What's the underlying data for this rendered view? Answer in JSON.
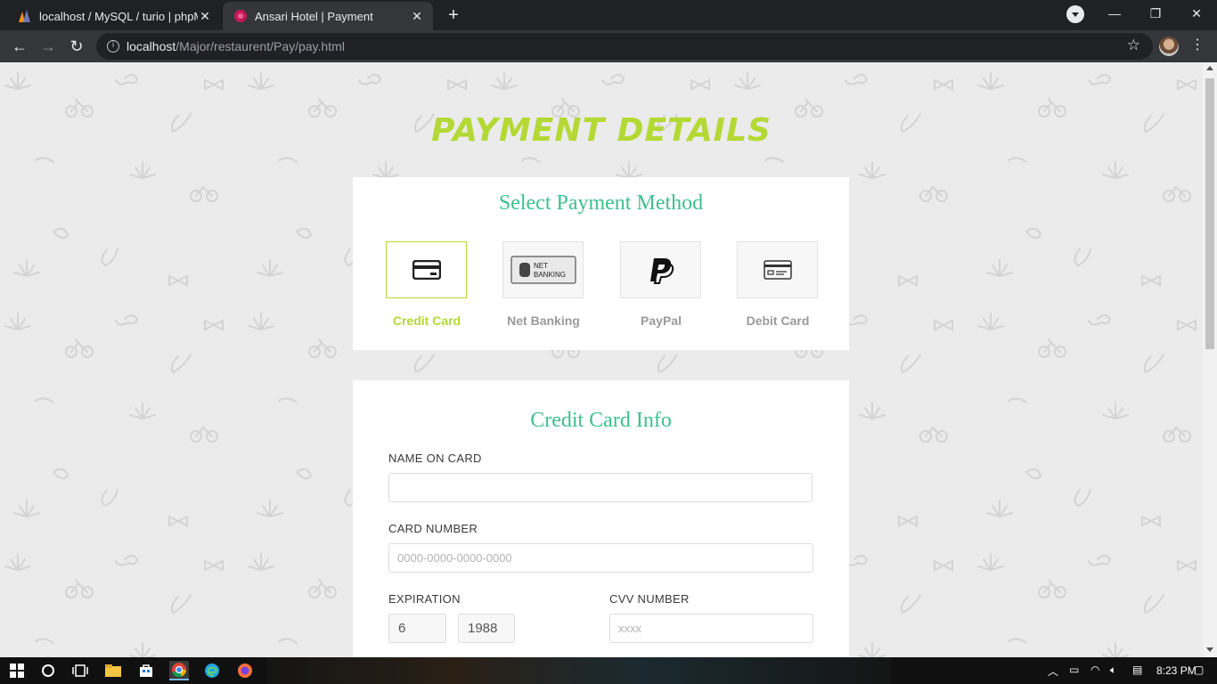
{
  "browser": {
    "tabs": [
      {
        "title": "localhost / MySQL / turio | phpM",
        "active": false
      },
      {
        "title": "Ansari Hotel | Payment",
        "active": true
      }
    ],
    "url_host": "localhost",
    "url_path": "/Major/restaurent/Pay/pay.html"
  },
  "page": {
    "heading": "PAYMENT DETAILS",
    "method_section_title": "Select Payment Method",
    "methods": [
      {
        "label": "Credit Card",
        "icon": "credit-card-icon",
        "selected": true
      },
      {
        "label": "Net Banking",
        "icon": "net-banking-icon",
        "selected": false
      },
      {
        "label": "PayPal",
        "icon": "paypal-icon",
        "selected": false
      },
      {
        "label": "Debit Card",
        "icon": "debit-card-icon",
        "selected": false
      }
    ],
    "net_banking_badge": [
      "NET",
      "BANKING"
    ],
    "form_title": "Credit Card Info",
    "name_label": "NAME ON CARD",
    "name_value": "",
    "card_number_label": "CARD NUMBER",
    "card_number_placeholder": "0000-0000-0000-0000",
    "expiration_label": "EXPIRATION",
    "exp_month": "6",
    "exp_year": "1988",
    "cvv_label": "CVV NUMBER",
    "cvv_placeholder": "xxxx"
  },
  "taskbar": {
    "time": "8:23 PM"
  },
  "colors": {
    "accent_green": "#b4d935",
    "title_teal": "#3ec08e"
  }
}
